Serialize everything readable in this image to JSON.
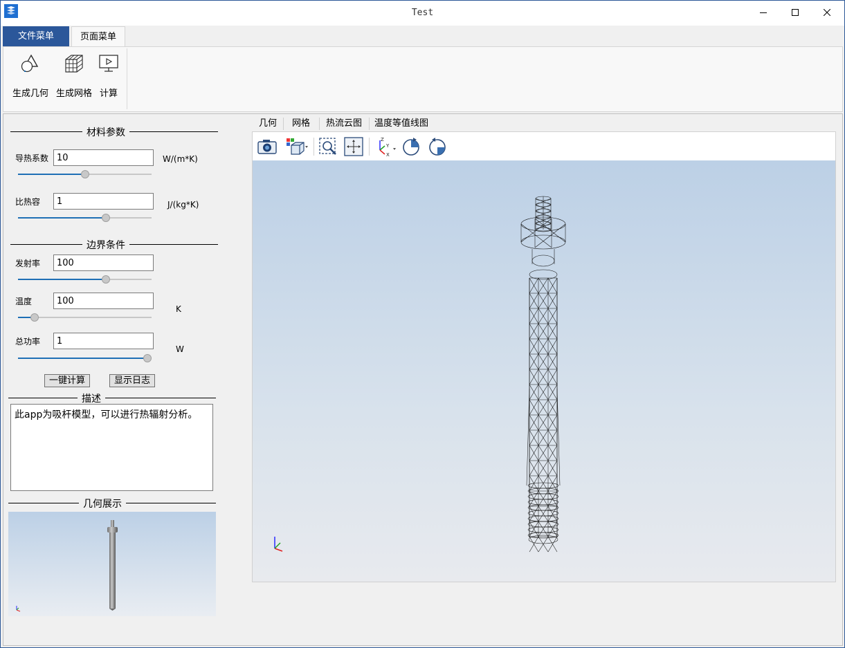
{
  "window": {
    "title": "Test",
    "accent_color": "#2b579a"
  },
  "ribbon": {
    "tabs": [
      {
        "label": "文件菜单",
        "active": false
      },
      {
        "label": "页面菜单",
        "active": true
      }
    ],
    "buttons": [
      {
        "label": "生成几何",
        "icon": "geometry-shapes-icon"
      },
      {
        "label": "生成网格",
        "icon": "mesh-cube-icon"
      },
      {
        "label": "计算",
        "icon": "monitor-play-icon"
      }
    ]
  },
  "left_panel": {
    "material_section": "材料参数",
    "boundary_section": "边界条件",
    "params": {
      "conductivity": {
        "label": "导热系数",
        "value": "10",
        "unit": "W/(m*K)",
        "slider_fraction": 0.5
      },
      "heat_capacity": {
        "label": "比热容",
        "value": "1",
        "unit": "J/(kg*K)",
        "slider_fraction": 0.67
      },
      "emissivity": {
        "label": "发射率",
        "value": "100",
        "unit": "",
        "slider_fraction": 0.67
      },
      "temperature": {
        "label": "温度",
        "value": "100",
        "unit": "K",
        "slider_fraction": 0.1
      },
      "total_power": {
        "label": "总功率",
        "value": "1",
        "unit": "W",
        "slider_fraction": 1.0
      }
    },
    "buttons": {
      "calculate": "一键计算",
      "show_log": "显示日志"
    },
    "description_section": "描述",
    "description_text": "此app为吸杆模型，可以进行热辐射分析。",
    "geometry_section": "几何展示"
  },
  "viewer": {
    "tabs": [
      "几何",
      "网格",
      "热流云图",
      "温度等值线图"
    ],
    "toolbar": [
      {
        "name": "camera-icon"
      },
      {
        "name": "view-cube-icon"
      },
      {
        "name": "zoom-box-icon"
      },
      {
        "name": "fit-all-icon"
      },
      {
        "name": "axes-icon"
      },
      {
        "name": "rotate-cw-icon"
      },
      {
        "name": "rotate-ccw-icon"
      }
    ],
    "axes_labels": {
      "z": "Z",
      "y": "Y",
      "x": "X"
    }
  }
}
